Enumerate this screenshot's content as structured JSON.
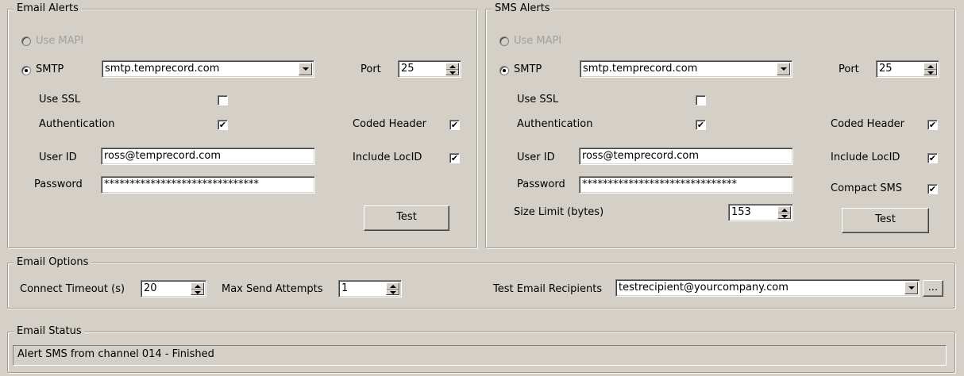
{
  "email_alerts": {
    "title": "Email Alerts",
    "use_mapi_label": "Use MAPI",
    "smtp_label": "SMTP",
    "smtp_server": "smtp.temprecord.com",
    "port_label": "Port",
    "port_value": "25",
    "use_ssl_label": "Use SSL",
    "use_ssl_checked": false,
    "authentication_label": "Authentication",
    "authentication_checked": true,
    "coded_header_label": "Coded Header",
    "coded_header_checked": true,
    "user_id_label": "User ID",
    "user_id_value": "ross@temprecord.com",
    "include_locid_label": "Include LocID",
    "include_locid_checked": true,
    "password_label": "Password",
    "password_value": "******************************",
    "test_label": "Test"
  },
  "sms_alerts": {
    "title": "SMS Alerts",
    "use_mapi_label": "Use MAPI",
    "smtp_label": "SMTP",
    "smtp_server": "smtp.temprecord.com",
    "port_label": "Port",
    "port_value": "25",
    "use_ssl_label": "Use SSL",
    "use_ssl_checked": false,
    "authentication_label": "Authentication",
    "authentication_checked": true,
    "coded_header_label": "Coded Header",
    "coded_header_checked": true,
    "user_id_label": "User ID",
    "user_id_value": "ross@temprecord.com",
    "include_locid_label": "Include LocID",
    "include_locid_checked": true,
    "password_label": "Password",
    "password_value": "******************************",
    "compact_sms_label": "Compact SMS",
    "compact_sms_checked": true,
    "size_limit_label": "Size Limit (bytes)",
    "size_limit_value": "153",
    "test_label": "Test"
  },
  "email_options": {
    "title": "Email Options",
    "connect_timeout_label": "Connect Timeout (s)",
    "connect_timeout_value": "20",
    "max_send_attempts_label": "Max Send Attempts",
    "max_send_attempts_value": "1",
    "test_recipients_label": "Test Email Recipients",
    "test_recipients_value": "testrecipient@yourcompany.com",
    "browse_label": "..."
  },
  "email_status": {
    "title": "Email Status",
    "status_text": "Alert SMS from channel 014 - Finished"
  },
  "icons": {
    "check_glyph": "✔"
  }
}
